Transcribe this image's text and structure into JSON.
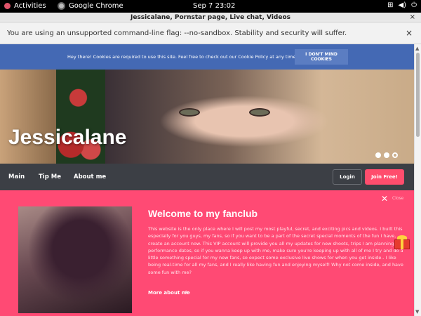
{
  "system": {
    "activities_label": "Activities",
    "app_name": "Google Chrome",
    "clock": "Sep 7  23:02"
  },
  "window": {
    "title": "Jessicalane, Pornstar page, Live chat, Videos",
    "close_glyph": "×"
  },
  "infobar": {
    "message": "You are using an unsupported command-line flag: --no-sandbox. Stability and security will suffer.",
    "close_glyph": "×"
  },
  "cookie": {
    "text": "Hey there! Cookies are required to use this site. Feel free to check out our Cookie Policy at any time.",
    "button_label": "I DON'T MIND COOKIES"
  },
  "hero": {
    "name": "Jessicalane",
    "slides_total": 3,
    "slide_active": 3
  },
  "nav": {
    "items": [
      "Main",
      "Tip Me",
      "About me"
    ],
    "login_label": "Login",
    "join_label": "Join Free!"
  },
  "fanclub": {
    "close_label": "Close",
    "title": "Welcome to my fanclub",
    "text": "This website is the only place where I will post my most playful, secret, and exciting pics and videos. I built this especially for you guys, my fans, so if you want to be a part of the secret special moments of the fun I have, create an account now. This VIP account will provide you all my updates for new shoots, trips I am planning, and performance dates, so if you wanna keep up with me, make sure you're keeping up with all of me I try and do a little something special for my new fans, so expect some exclusive live shows for when you get inside.. I like being real-time for all my fans, and I really like having fun and enjoying myself! Why not come inside, and have some fun with me?",
    "more_label": "More about me"
  },
  "colors": {
    "cookie_bar": "#4469b4",
    "nav_bar": "#3c3f45",
    "accent_pink": "#ff4a74",
    "join_button": "#ff4d6d"
  }
}
